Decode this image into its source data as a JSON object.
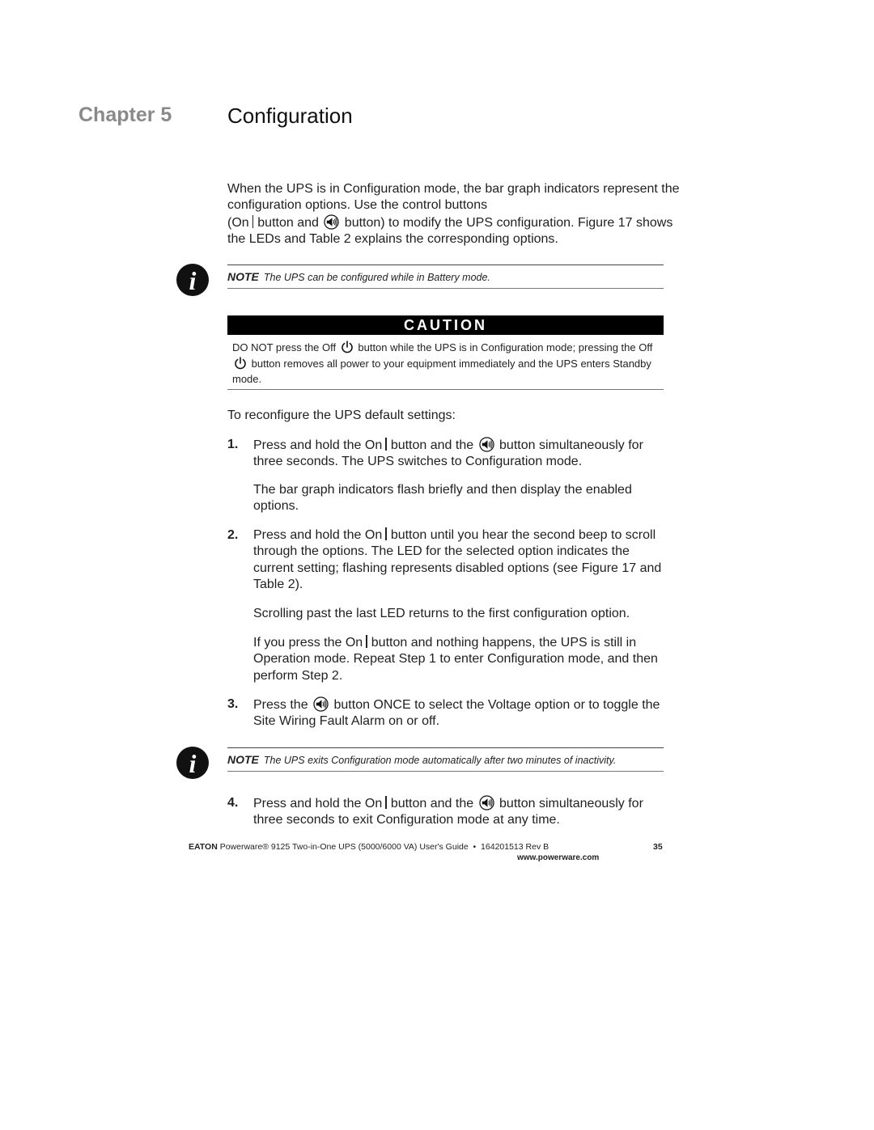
{
  "header": {
    "chapter_label": "Chapter 5",
    "chapter_title": "Configuration"
  },
  "intro": {
    "line1": "When the UPS is in Configuration mode, the bar graph indicators represent the configuration options. Use the control buttons",
    "line2_a": "(On",
    "line2_b": "button and",
    "line2_c": "button) to modify the UPS configuration. Figure 17 shows the LEDs and Table 2 explains the corresponding options."
  },
  "note1": {
    "label": "NOTE",
    "text": "The UPS can be configured while in Battery mode."
  },
  "caution": {
    "title": "CAUTION",
    "text_a": "DO NOT press the Off",
    "text_b": "button while the UPS is in Configuration mode; pressing the Off",
    "text_c": "button removes all power to your equipment immediately and the UPS enters Standby mode."
  },
  "procedure": {
    "lead": "To reconfigure the UPS default settings:",
    "steps": [
      {
        "num": "1.",
        "a": "Press and hold the On",
        "b": "button and the",
        "c": "button simultaneously for three seconds. The UPS switches to Configuration mode.",
        "sub": [
          "The bar graph indicators flash briefly and then display the enabled options."
        ]
      },
      {
        "num": "2.",
        "a": "Press and hold the On",
        "b": "button until you hear the second beep to scroll through the options. The LED for the selected option indicates the current setting; flashing represents disabled options (see Figure 17 and Table 2).",
        "sub": [
          "Scrolling past the last LED returns to the first configuration option.",
          "If you press the On",
          "button and nothing happens, the UPS is still in Operation mode. Repeat Step 1 to enter Configuration mode, and then perform Step 2."
        ]
      },
      {
        "num": "3.",
        "a": "Press the",
        "b": "button ONCE to select the Voltage option or to toggle the Site Wiring Fault Alarm on or off."
      },
      {
        "num": "4.",
        "a": "Press and hold the On",
        "b": "button and the",
        "c": "button simultaneously for three seconds to exit Configuration mode at any time."
      }
    ]
  },
  "note2": {
    "label": "NOTE",
    "text": "The UPS exits Configuration mode automatically after two minutes of inactivity."
  },
  "footer": {
    "brand": "EATON",
    "text": "Powerware® 9125 Two-in-One UPS (5000/6000 VA) User's Guide  •  164201513 Rev B",
    "url": "www.powerware.com",
    "page": "35"
  },
  "icons": {
    "info": "info-icon",
    "speaker": "alarm-speaker-icon",
    "power": "power-icon",
    "on_bar": "on-bar-icon"
  }
}
